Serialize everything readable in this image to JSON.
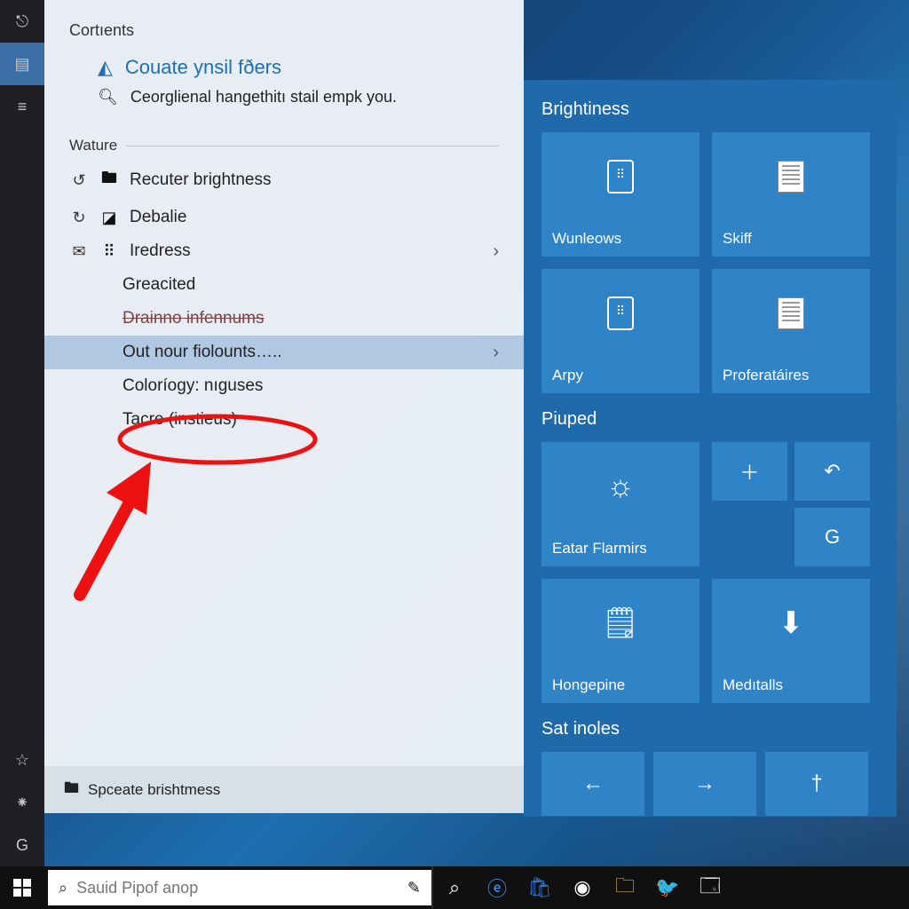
{
  "menu": {
    "section1": "Cortıents",
    "accent_label": "Couate ynsil fðers",
    "sub_label": "Ceorglienal hangethitı stail empk you.",
    "section2": "Wature",
    "items": {
      "brightness": "Recuter brightness",
      "debalie": "Debalie",
      "iredress": "Iredress",
      "greacited": "Greacited",
      "drainno": "Drainno infennums",
      "outnour": "Out nour fiolounts…..",
      "colorlogy": "Coloríogy: nıguses",
      "tacre": "Tacre (instieus)"
    },
    "bottom": "Spceate brishtmess"
  },
  "tiles": {
    "group1": "Brightiness",
    "g1": {
      "t1": "Wunleows",
      "t2": "Skiff",
      "t3": "Arpy",
      "t4": "Proferatáires"
    },
    "group2": "Piuped",
    "g2": {
      "t1": "Eatar Flarmirs",
      "t2": "Hongepine",
      "t3": "Medıtalls"
    },
    "group3": "Sat inoles"
  },
  "taskbar": {
    "search_placeholder": "Sauid Pipof anop"
  },
  "icons": {
    "alert": "⚠",
    "search": "🔍",
    "refresh": "↻",
    "speech": "💬",
    "folder": "🗀",
    "sun": "☀",
    "plus": "+",
    "undo": "↶",
    "g": "G",
    "clip": "🗒",
    "down": "↓",
    "left": "←",
    "right": "→",
    "wand": "†",
    "star": "☆",
    "bt": "✱",
    "menu": "≡",
    "pin": "📌"
  }
}
